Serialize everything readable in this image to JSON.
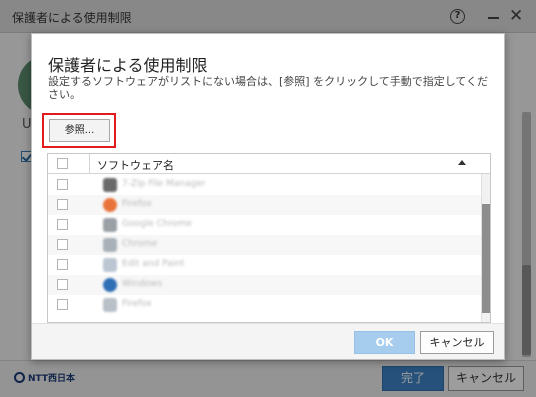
{
  "background_window": {
    "title": "保護者による使用制限",
    "help_icon": "help-circle-icon",
    "help_glyph": "?",
    "minimize_icon": "minimize-icon",
    "close_icon": "close-icon",
    "close_glyph": "✕",
    "partial_letter": "U",
    "logo_text": "NTT西日本",
    "done_label": "完了",
    "cancel_label": "キャンセル"
  },
  "dialog": {
    "title": "保護者による使用制限",
    "description": "設定するソフトウェアがリストにない場合は、[参照] をクリックして手動で指定してください。",
    "browse_label": "参照...",
    "list": {
      "column_header": "ソフトウェア名",
      "sort_icon": "sort-ascending-icon",
      "rows": [
        {
          "name": "7-Zip File Manager",
          "icon_color": "#6a6a6a"
        },
        {
          "name": "Firefox",
          "icon_color": "#e8733a"
        },
        {
          "name": "Google Chrome",
          "icon_color": "#9aa0a6"
        },
        {
          "name": "Chrome",
          "icon_color": "#a8b0b8"
        },
        {
          "name": "Edit and Paint",
          "icon_color": "#bcc6d3"
        },
        {
          "name": "Windows",
          "icon_color": "#2f6fb5"
        },
        {
          "name": "Firefox",
          "icon_color": "#b8c0c8"
        }
      ]
    },
    "ok_label": "OK",
    "cancel_label": "キャンセル"
  },
  "colors": {
    "highlight_frame": "#e01b1b",
    "primary_button": "#3d83c6",
    "ok_disabled": "#a6cdee"
  }
}
